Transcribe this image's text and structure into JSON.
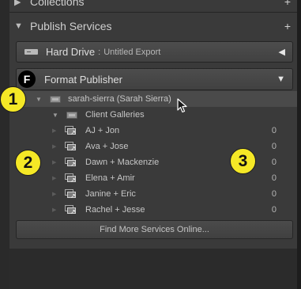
{
  "collections_header": {
    "title": "Collections",
    "expand_glyph": "▶",
    "plus_glyph": "+"
  },
  "publish_header": {
    "title": "Publish Services",
    "expand_glyph": "▼",
    "plus_glyph": "+"
  },
  "hard_drive": {
    "name": "Hard Drive",
    "separator": ":",
    "subtitle": "Untitled Export",
    "arrow_glyph": "◀"
  },
  "format_publisher": {
    "logo_letter": "F",
    "name": "Format Publisher",
    "arrow_glyph": "▼"
  },
  "account": {
    "label": "sarah-sierra (Sarah Sierra)",
    "expand_glyph": "▼"
  },
  "set": {
    "label": "Client Galleries",
    "expand_glyph": "▼"
  },
  "galleries": [
    {
      "label": "AJ + Jon",
      "count": "0"
    },
    {
      "label": "Ava + Jose",
      "count": "0"
    },
    {
      "label": "Dawn + Mackenzie",
      "count": "0"
    },
    {
      "label": "Elena + Amir",
      "count": "0"
    },
    {
      "label": "Janine + Eric",
      "count": "0"
    },
    {
      "label": "Rachel + Jesse",
      "count": "0"
    }
  ],
  "find_more_button": "Find More Services Online...",
  "callouts": [
    "1",
    "2",
    "3"
  ],
  "colors": {
    "callout_fill": "#f5e826",
    "panel_bg": "#3a3a3a"
  }
}
